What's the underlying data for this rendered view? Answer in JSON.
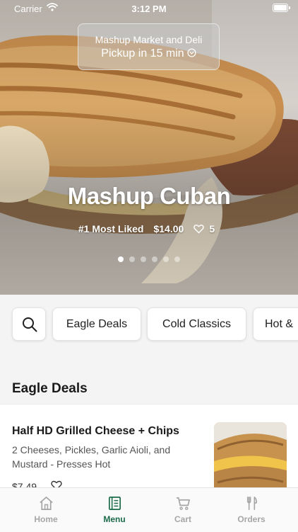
{
  "status_bar": {
    "carrier": "Carrier",
    "time": "3:12 PM"
  },
  "pickup": {
    "store": "Mashup Market and Deli",
    "time_label": "Pickup in 15 min"
  },
  "hero": {
    "title": "Mashup Cuban",
    "badge": "#1 Most Liked",
    "price": "$14.00",
    "likes": "5",
    "slide_count": 6,
    "active_slide": 1
  },
  "categories": [
    "Eagle Deals",
    "Cold Classics",
    "Hot &"
  ],
  "section": {
    "title": "Eagle Deals",
    "items": [
      {
        "name": "Half HD Grilled Cheese + Chips",
        "description": "2 Cheeses, Pickles, Garlic Aioli, and Mustard - Presses Hot",
        "price": "$7.49"
      }
    ]
  },
  "tabs": [
    {
      "label": "Home",
      "icon": "home-icon"
    },
    {
      "label": "Menu",
      "icon": "menu-icon"
    },
    {
      "label": "Cart",
      "icon": "cart-icon"
    },
    {
      "label": "Orders",
      "icon": "fork-knife-icon"
    }
  ],
  "active_tab": "Menu",
  "colors": {
    "accent": "#1c6b4a",
    "inactive_tab": "#a6a6a6",
    "background": "#f4f4f4"
  }
}
